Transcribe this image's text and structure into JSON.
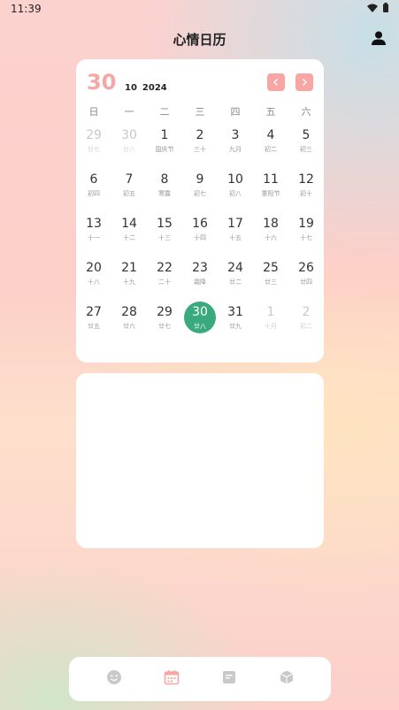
{
  "status": {
    "time": "11:39"
  },
  "header": {
    "title": "心情日历"
  },
  "calendar": {
    "selected_day": "30",
    "month": "10",
    "year": "2024",
    "weekdays": [
      "日",
      "一",
      "二",
      "三",
      "四",
      "五",
      "六"
    ],
    "weeks": [
      [
        {
          "d": "29",
          "s": "廿七",
          "o": true
        },
        {
          "d": "30",
          "s": "廿八",
          "o": true
        },
        {
          "d": "1",
          "s": "国庆节"
        },
        {
          "d": "2",
          "s": "三十"
        },
        {
          "d": "3",
          "s": "九月"
        },
        {
          "d": "4",
          "s": "初二"
        },
        {
          "d": "5",
          "s": "初三"
        }
      ],
      [
        {
          "d": "6",
          "s": "初四"
        },
        {
          "d": "7",
          "s": "初五"
        },
        {
          "d": "8",
          "s": "寒露"
        },
        {
          "d": "9",
          "s": "初七"
        },
        {
          "d": "10",
          "s": "初八"
        },
        {
          "d": "11",
          "s": "重阳节"
        },
        {
          "d": "12",
          "s": "初十"
        }
      ],
      [
        {
          "d": "13",
          "s": "十一"
        },
        {
          "d": "14",
          "s": "十二"
        },
        {
          "d": "15",
          "s": "十三"
        },
        {
          "d": "16",
          "s": "十四"
        },
        {
          "d": "17",
          "s": "十五"
        },
        {
          "d": "18",
          "s": "十六"
        },
        {
          "d": "19",
          "s": "十七"
        }
      ],
      [
        {
          "d": "20",
          "s": "十八"
        },
        {
          "d": "21",
          "s": "十九"
        },
        {
          "d": "22",
          "s": "二十"
        },
        {
          "d": "23",
          "s": "霜降"
        },
        {
          "d": "24",
          "s": "廿二"
        },
        {
          "d": "25",
          "s": "廿三"
        },
        {
          "d": "26",
          "s": "廿四"
        }
      ],
      [
        {
          "d": "27",
          "s": "廿五"
        },
        {
          "d": "28",
          "s": "廿六"
        },
        {
          "d": "29",
          "s": "廿七"
        },
        {
          "d": "30",
          "s": "廿八",
          "t": true
        },
        {
          "d": "31",
          "s": "廿九"
        },
        {
          "d": "1",
          "s": "十月",
          "o": true
        },
        {
          "d": "2",
          "s": "初二",
          "o": true
        }
      ]
    ]
  },
  "tabs": [
    {
      "icon": "smiley-icon",
      "active": false
    },
    {
      "icon": "calendar-icon",
      "active": true
    },
    {
      "icon": "note-icon",
      "active": false
    },
    {
      "icon": "box-icon",
      "active": false
    }
  ],
  "colors": {
    "accent": "#f7a6a3",
    "today": "#3aaa7e",
    "inactive_icon": "#c9c9c9"
  }
}
